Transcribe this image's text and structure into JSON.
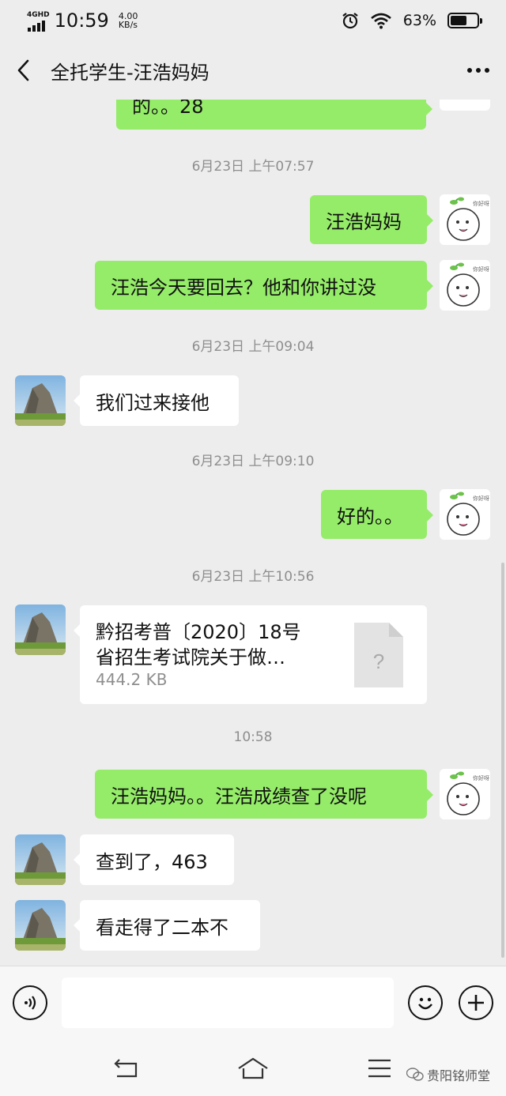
{
  "status": {
    "network": "4GHD",
    "time": "10:59",
    "speed_value": "4.00",
    "speed_unit": "KB/s",
    "battery": "63%"
  },
  "header": {
    "title": "全托学生-汪浩妈妈"
  },
  "messages": [
    {
      "type": "text",
      "side": "me",
      "text": "的。。28"
    },
    {
      "type": "time",
      "text": "6月23日 上午07:57"
    },
    {
      "type": "text",
      "side": "me",
      "text": "汪浩妈妈"
    },
    {
      "type": "text",
      "side": "me",
      "text": "汪浩今天要回去？他和你讲过没"
    },
    {
      "type": "time",
      "text": "6月23日 上午09:04"
    },
    {
      "type": "text",
      "side": "other",
      "text": "我们过来接他"
    },
    {
      "type": "time",
      "text": "6月23日 上午09:10"
    },
    {
      "type": "text",
      "side": "me",
      "text": "好的。。"
    },
    {
      "type": "time",
      "text": "6月23日 上午10:56"
    },
    {
      "type": "file",
      "side": "other",
      "name_line1": "黔招考普〔2020〕18号",
      "name_line2": "省招生考试院关于做…",
      "size": "444.2 KB"
    },
    {
      "type": "time",
      "text": "10:58"
    },
    {
      "type": "text",
      "side": "me",
      "text": "汪浩妈妈。。汪浩成绩查了没呢"
    },
    {
      "type": "text",
      "side": "other",
      "text": "查到了，463"
    },
    {
      "type": "text",
      "side": "other",
      "text": "看走得了二本不"
    }
  ],
  "input": {
    "placeholder": ""
  },
  "watermark": "贵阳铭师堂",
  "colors": {
    "me_bubble": "#95ec69",
    "other_bubble": "#ffffff",
    "background": "#ededed"
  },
  "icons": [
    "back-arrow-icon",
    "more-icon",
    "voice-icon",
    "emoji-icon",
    "plus-icon",
    "nav-back-icon",
    "nav-home-icon",
    "nav-menu-icon"
  ]
}
